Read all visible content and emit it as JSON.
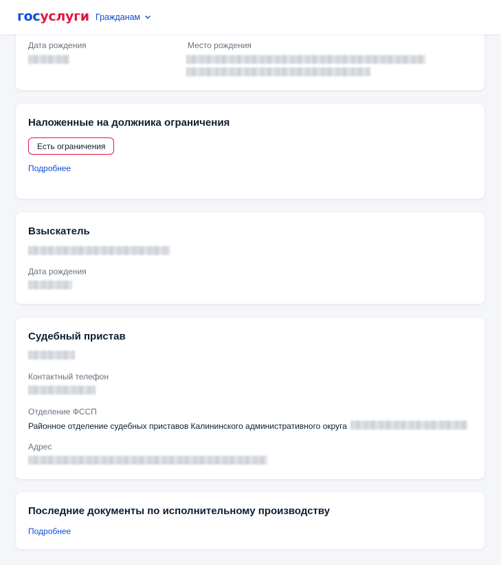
{
  "header": {
    "logo_part1": "гос",
    "logo_part2": "услуги",
    "nav_label": "Гражданам"
  },
  "debtor_card": {
    "birth_date_label": "Дата рождения",
    "birth_place_label": "Место рождения"
  },
  "restrictions_card": {
    "title": "Наложенные на должника ограничения",
    "badge": "Есть ограничения",
    "more_link": "Подробнее"
  },
  "claimant_card": {
    "title": "Взыскатель",
    "birth_date_label": "Дата рождения"
  },
  "bailiff_card": {
    "title": "Судебный пристав",
    "phone_label": "Контактный телефон",
    "department_label": "Отделение ФССП",
    "department_value": "Районное отделение судебных приставов Калининского административного округа",
    "address_label": "Адрес"
  },
  "documents_card": {
    "title": "Последние документы по исполнительному производству",
    "more_link": "Подробнее"
  },
  "colors": {
    "brand_blue": "#0d4cd3",
    "brand_red": "#e3173d",
    "background": "#f4f6f9"
  },
  "icons": {
    "nav_chevron": "chevron-down-icon"
  }
}
